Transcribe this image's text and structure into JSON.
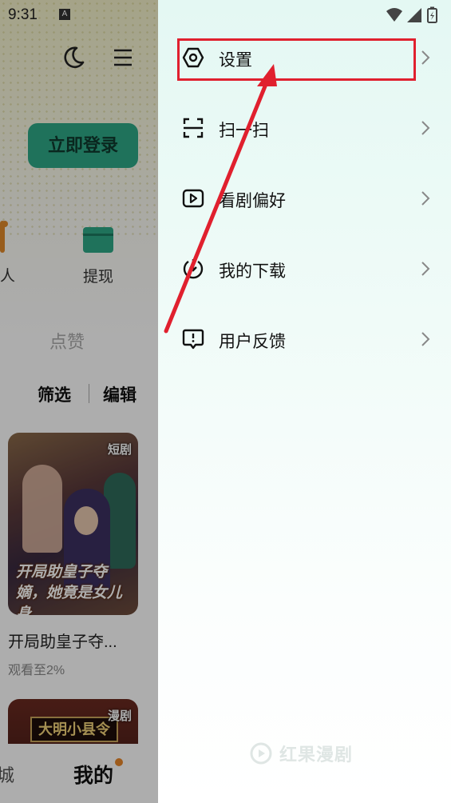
{
  "status_bar": {
    "time": "9:31",
    "notification_glyph": "A",
    "icons": [
      "wifi-icon",
      "signal-icon",
      "battery-icon"
    ]
  },
  "background_page": {
    "login_button": "立即登录",
    "partial_left_label": "人",
    "withdraw_label": "提现",
    "like_tab": "点赞",
    "filter_button": "筛选",
    "edit_button": "编辑",
    "items": [
      {
        "tag": "短剧",
        "poster_title": "开局助皇子夺嫡，她竟是女儿身",
        "title": "开局助皇子夺...",
        "progress": "观看至2%"
      },
      {
        "tag": "漫剧",
        "poster_title": "大明小县令"
      }
    ],
    "bottom_nav": {
      "partial_label": "城",
      "mine_label": "我的"
    }
  },
  "drawer": {
    "menu": [
      {
        "label": "设置",
        "icon": "settings-hexagon-icon"
      },
      {
        "label": "扫一扫",
        "icon": "scan-icon"
      },
      {
        "label": "看剧偏好",
        "icon": "play-preference-icon"
      },
      {
        "label": "我的下载",
        "icon": "download-icon"
      },
      {
        "label": "用户反馈",
        "icon": "feedback-icon"
      }
    ],
    "watermark": "红果漫剧"
  },
  "colors": {
    "accent_green": "#2fa887",
    "highlight_red": "#e0202e",
    "badge_orange": "#e8862a"
  }
}
